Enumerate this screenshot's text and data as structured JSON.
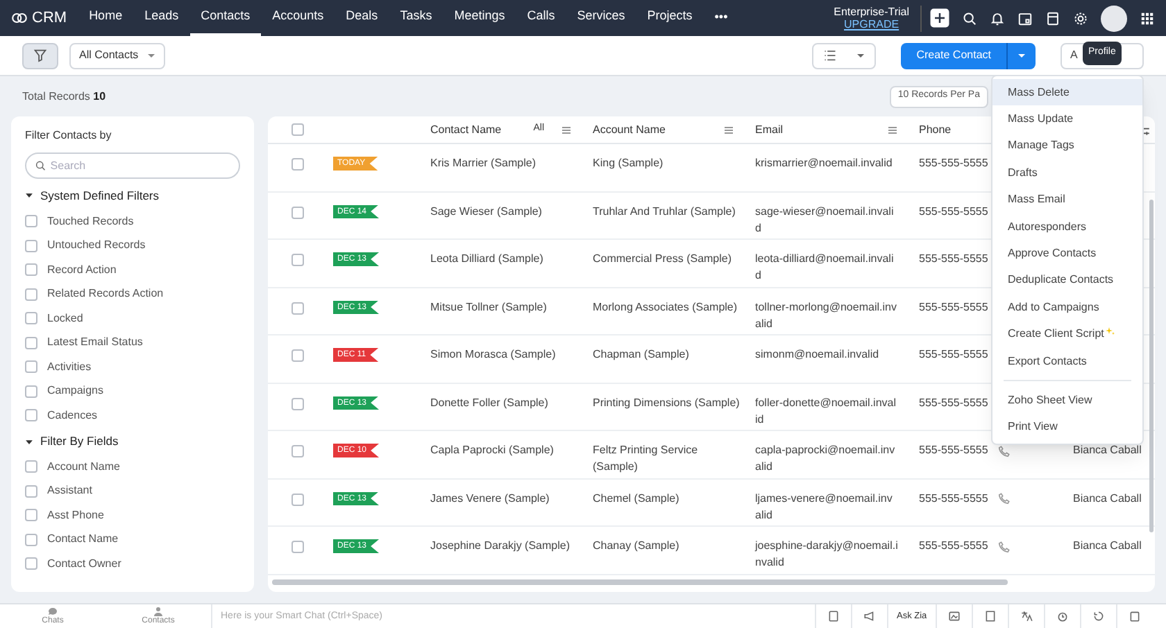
{
  "nav": {
    "logo": "CRM",
    "tabs": [
      {
        "label": "Home",
        "selected": false
      },
      {
        "label": "Leads",
        "selected": false
      },
      {
        "label": "Contacts",
        "selected": true
      },
      {
        "label": "Accounts",
        "selected": false
      },
      {
        "label": "Deals",
        "selected": false
      },
      {
        "label": "Tasks",
        "selected": false
      },
      {
        "label": "Meetings",
        "selected": false
      },
      {
        "label": "Calls",
        "selected": false
      },
      {
        "label": "Services",
        "selected": false
      },
      {
        "label": "Projects",
        "selected": false
      }
    ],
    "more": "•••",
    "plan": "Enterprise-Trial",
    "upgrade": "UPGRADE"
  },
  "toolbar": {
    "view": "All Contacts",
    "create": "Create Contact",
    "actions": "A",
    "tooltip": "Profile"
  },
  "summary": {
    "label": "Total Records",
    "count": "10",
    "per_page": "10 Records Per Pa"
  },
  "filter": {
    "title": "Filter Contacts by",
    "search_placeholder": "Search",
    "sections": [
      {
        "title": "System Defined Filters",
        "expanded": true,
        "items": [
          {
            "label": "Touched Records",
            "checked": false
          },
          {
            "label": "Untouched Records",
            "checked": false
          },
          {
            "label": "Record Action",
            "checked": false
          },
          {
            "label": "Related Records Action",
            "checked": false
          },
          {
            "label": "Locked",
            "checked": false
          },
          {
            "label": "Latest Email Status",
            "checked": false
          },
          {
            "label": "Activities",
            "checked": false
          },
          {
            "label": "Campaigns",
            "checked": false
          },
          {
            "label": "Cadences",
            "checked": false
          }
        ]
      },
      {
        "title": "Filter By Fields",
        "expanded": true,
        "items": [
          {
            "label": "Account Name",
            "checked": false
          },
          {
            "label": "Assistant",
            "checked": false
          },
          {
            "label": "Asst Phone",
            "checked": false
          },
          {
            "label": "Contact Name",
            "checked": false
          },
          {
            "label": "Contact Owner",
            "checked": false
          }
        ]
      }
    ]
  },
  "table": {
    "header_checked": false,
    "columns": [
      {
        "label": "Contact Name",
        "filter": "All"
      },
      {
        "label": "Account Name"
      },
      {
        "label": "Email"
      },
      {
        "label": "Phone"
      }
    ],
    "rows": [
      {
        "tag": "TODAY",
        "color": "#f0a030",
        "name": "Kris Marrier (Sample)",
        "account": "King (Sample)",
        "email": "krismarrier@noemail.invalid",
        "phone": "555-555-5555",
        "checked": false
      },
      {
        "tag": "DEC 14",
        "color": "#1ea158",
        "name": "Sage Wieser (Sample)",
        "account": "Truhlar And Truhlar (Sample)",
        "email": "sage-wieser@noemail.invalid",
        "phone": "555-555-5555",
        "checked": false
      },
      {
        "tag": "DEC 13",
        "color": "#1ea158",
        "name": "Leota Dilliard (Sample)",
        "account": "Commercial Press (Sample)",
        "email": "leota-dilliard@noemail.invalid",
        "phone": "555-555-5555",
        "checked": false
      },
      {
        "tag": "DEC 13",
        "color": "#1ea158",
        "name": "Mitsue Tollner (Sample)",
        "account": "Morlong Associates (Sample)",
        "email": "tollner-morlong@noemail.invalid",
        "phone": "555-555-5555",
        "checked": false
      },
      {
        "tag": "DEC 11",
        "color": "#e5383b",
        "name": "Simon Morasca (Sample)",
        "account": "Chapman (Sample)",
        "email": "simonm@noemail.invalid",
        "phone": "555-555-5555",
        "checked": false
      },
      {
        "tag": "DEC 13",
        "color": "#1ea158",
        "name": "Donette Foller (Sample)",
        "account": "Printing Dimensions (Sample)",
        "email": "foller-donette@noemail.invalid",
        "phone": "555-555-5555",
        "checked": false
      },
      {
        "tag": "DEC 10",
        "color": "#e5383b",
        "name": "Capla Paprocki (Sample)",
        "account": "Feltz Printing Service (Sample)",
        "email": "capla-paprocki@noemail.invalid",
        "phone": "555-555-5555",
        "owner": "Bianca Caball",
        "checked": false
      },
      {
        "tag": "DEC 13",
        "color": "#1ea158",
        "name": "James Venere (Sample)",
        "account": "Chemel (Sample)",
        "email": "ljames-venere@noemail.invalid",
        "phone": "555-555-5555",
        "owner": "Bianca Caball",
        "checked": false
      },
      {
        "tag": "DEC 13",
        "color": "#1ea158",
        "name": "Josephine Darakjy (Sample)",
        "account": "Chanay (Sample)",
        "email": "joesphine-darakjy@noemail.invalid",
        "phone": "555-555-5555",
        "owner": "Bianca Caball",
        "checked": false
      }
    ]
  },
  "menu": {
    "groups": [
      [
        {
          "label": "Mass Delete",
          "selected": true
        },
        {
          "label": "Mass Update",
          "selected": false
        },
        {
          "label": "Manage Tags",
          "selected": false
        },
        {
          "label": "Drafts",
          "selected": false
        },
        {
          "label": "Mass Email",
          "selected": false
        },
        {
          "label": "Autoresponders",
          "selected": false
        },
        {
          "label": "Approve Contacts",
          "selected": false
        },
        {
          "label": "Deduplicate Contacts",
          "selected": false
        },
        {
          "label": "Add to Campaigns",
          "selected": false
        },
        {
          "label": "Create Client Script",
          "selected": false,
          "new": true
        },
        {
          "label": "Export Contacts",
          "selected": false
        }
      ],
      [
        {
          "label": "Zoho Sheet View",
          "selected": false
        },
        {
          "label": "Print View",
          "selected": false
        }
      ]
    ]
  },
  "footer": {
    "tabs": [
      "Chats",
      "Contacts"
    ],
    "chat_placeholder": "Here is your Smart Chat (Ctrl+Space)",
    "ask": "Ask Zia"
  }
}
